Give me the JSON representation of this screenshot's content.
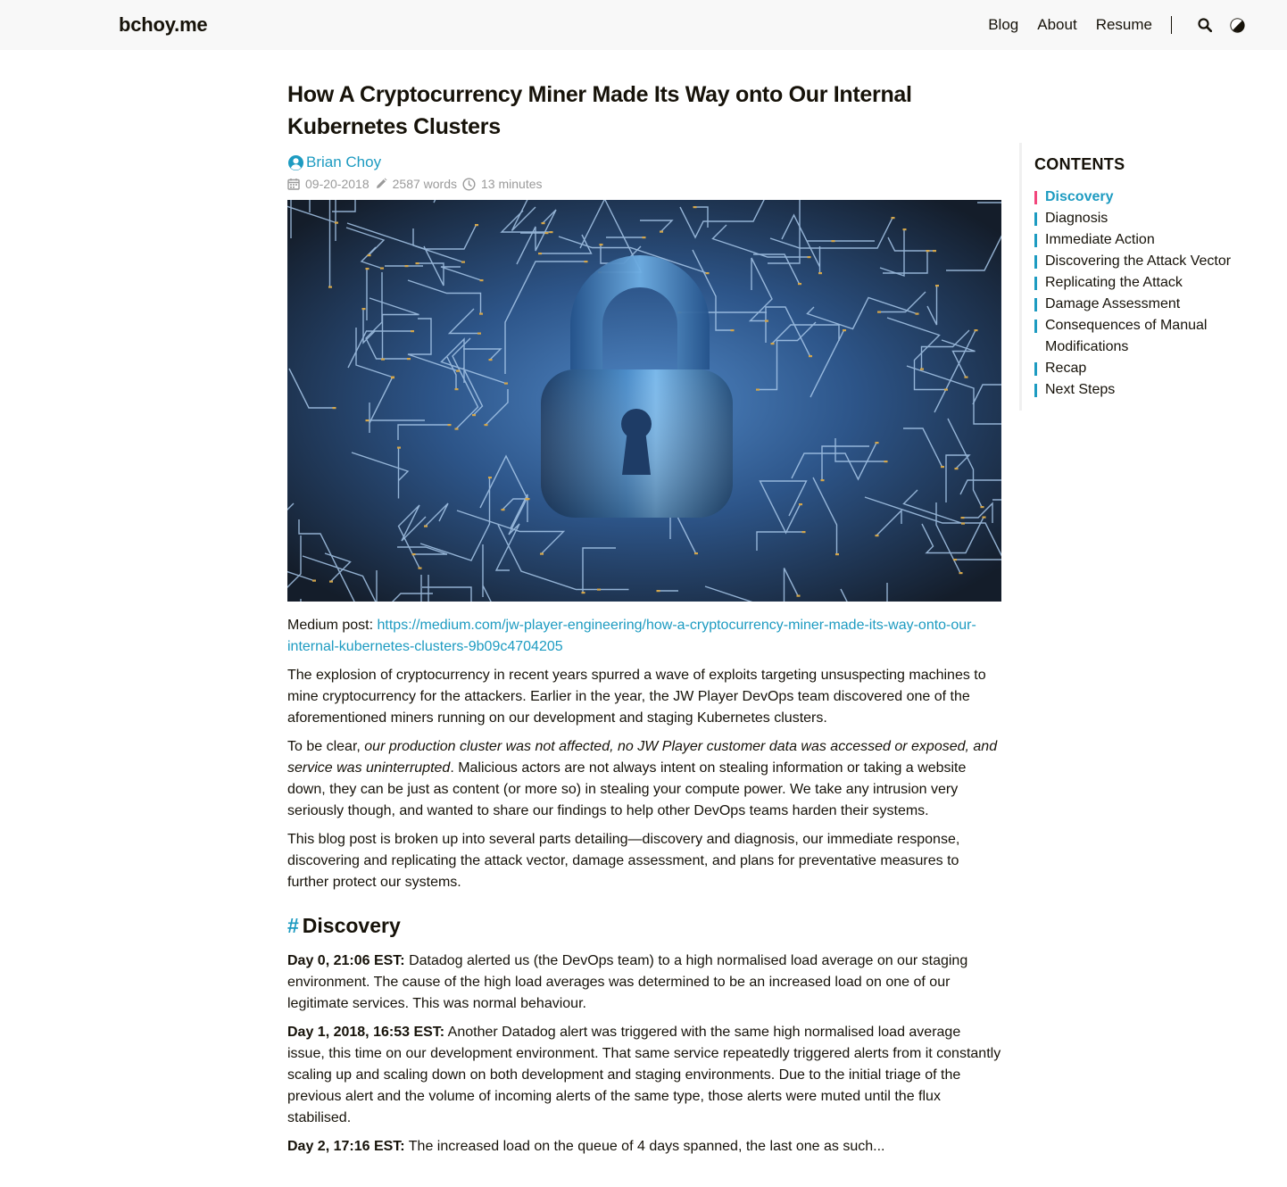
{
  "header": {
    "brand": "bchoy.me",
    "nav": [
      "Blog",
      "About",
      "Resume"
    ],
    "search_icon": "search-icon",
    "theme_icon": "contrast-icon"
  },
  "post": {
    "title": "How A Cryptocurrency Miner Made Its Way onto Our Internal Kubernetes Clusters",
    "author": "Brian Choy",
    "date": "09-20-2018",
    "words": "2587 words",
    "reading_time": "13 minutes",
    "hero_alt": "padlock-circuit-board-image",
    "medium_label": "Medium post:",
    "medium_url": "https://medium.com/jw-player-engineering/how-a-cryptocurrency-miner-made-its-way-onto-our-internal-kubernetes-clusters-9b09c4704205",
    "p1": "The explosion of cryptocurrency in recent years spurred a wave of exploits targeting unsuspecting machines to mine cryptocurrency for the attackers. Earlier in the year, the JW Player DevOps team discovered one of the aforementioned miners running on our development and staging Kubernetes clusters.",
    "p2_lead": "To be clear, ",
    "p2_em": "our production cluster was not affected, no JW Player customer data was accessed or exposed, and service was uninterrupted",
    "p2_rest": ". Malicious actors are not always intent on stealing information or taking a website down, they can be just as content (or more so) in stealing your compute power. We take any intrusion very seriously though, and wanted to share our findings to help other DevOps teams harden their systems.",
    "p3": "This blog post is broken up into several parts detailing—discovery and diagnosis, our immediate response, discovering and replicating the attack vector, damage assessment, and plans for preventative measures to further protect our systems.",
    "h2_hash": "#",
    "h2": "Discovery",
    "d0_label": "Day 0, 21:06 EST:",
    "d0_text": " Datadog alerted us (the DevOps team) to a high normalised load average on our staging environment. The cause of the high load averages was determined to be an increased load on one of our legitimate services. This was normal behaviour.",
    "d1_label": "Day 1, 2018, 16:53 EST:",
    "d1_text": " Another Datadog alert was triggered with the same high normalised load average issue, this time on our development environment. That same service repeatedly triggered alerts from it constantly scaling up and scaling down on both development and staging environments. Due to the initial triage of the previous alert and the volume of incoming alerts of the same type, those alerts were muted until the flux stabilised.",
    "d2_label": "Day 2, 17:16 EST:",
    "d2_text": " The increased load on the queue of 4 days spanned, the last one as such..."
  },
  "toc": {
    "title": "CONTENTS",
    "items": [
      "Discovery",
      "Diagnosis",
      "Immediate Action",
      "Discovering the Attack Vector",
      "Replicating the Attack",
      "Damage Assessment",
      "Consequences of Manual Modifications",
      "Recap",
      "Next Steps"
    ],
    "active_index": 0
  },
  "colors": {
    "accent": "#1d9bc1",
    "active_marker": "#f2467c",
    "text": "#161209",
    "muted": "#9a9a9a",
    "header_bg": "#f8f8f8"
  }
}
